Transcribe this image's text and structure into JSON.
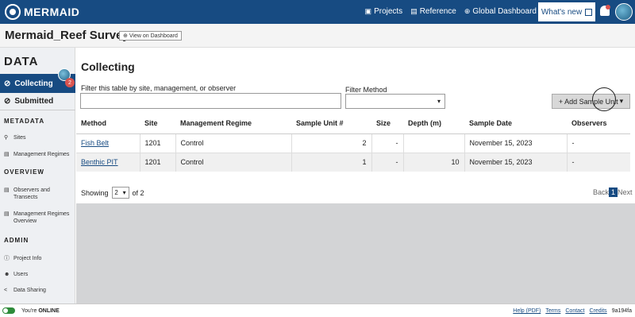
{
  "app": {
    "name": "MERMAID"
  },
  "topnav": {
    "projects": "Projects",
    "reference": "Reference",
    "global_dashboard": "Global Dashboard",
    "whats_new": "What's new"
  },
  "project": {
    "title": "Mermaid_Reef Survey",
    "view_dashboard": "View on Dashboard"
  },
  "sidebar": {
    "data_heading": "DATA",
    "collecting": "Collecting",
    "collecting_badge": "2",
    "submitted": "Submitted",
    "metadata_heading": "METADATA",
    "sites": "Sites",
    "management_regimes": "Management Regimes",
    "overview_heading": "OVERVIEW",
    "observers_transects": "Observers and Transects",
    "mr_overview": "Management Regimes Overview",
    "admin_heading": "ADMIN",
    "project_info": "Project Info",
    "users": "Users",
    "data_sharing": "Data Sharing"
  },
  "main": {
    "title": "Collecting",
    "filter_label": "Filter this table by site, management, or observer",
    "filter_value": "",
    "method_label": "Filter Method",
    "method_value": "",
    "add_button": "+ Add Sample Unit"
  },
  "table": {
    "headers": [
      "Method",
      "Site",
      "Management Regime",
      "Sample Unit #",
      "Size",
      "Depth (m)",
      "Sample Date",
      "Observers"
    ],
    "rows": [
      [
        "Fish Belt",
        "1201",
        "Control",
        "2",
        "-",
        "",
        "November 15, 2023",
        "-"
      ],
      [
        "Benthic PIT",
        "1201",
        "Control",
        "1",
        "-",
        "10",
        "November 15, 2023",
        "-"
      ]
    ]
  },
  "pagination": {
    "showing": "Showing",
    "page_size": "2",
    "of_text": "of 2",
    "back": "Back",
    "current": "1",
    "next": "Next"
  },
  "footer": {
    "youre": "You're",
    "online": "ONLINE",
    "help": "Help (PDF)",
    "terms": "Terms",
    "contact": "Contact",
    "credits": "Credits",
    "version": "9a194fa"
  },
  "colors": {
    "brand": "#174b82",
    "badge": "#d9534f",
    "online": "#2e8b3a"
  },
  "icons": [
    "logo-icon",
    "folder-icon",
    "book-icon",
    "globe-icon",
    "external-link-icon",
    "bell-icon",
    "check-circle-icon",
    "pin-icon",
    "doc-icon",
    "share-icon",
    "users-icon",
    "info-icon"
  ]
}
